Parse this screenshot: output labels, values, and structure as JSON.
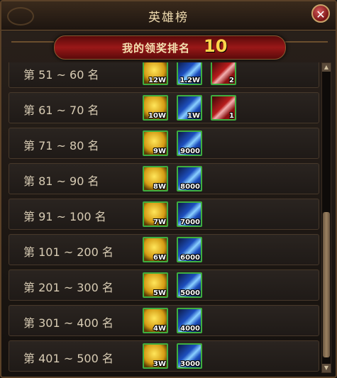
{
  "window": {
    "title": "英雄榜",
    "close_icon": "close-icon"
  },
  "banner": {
    "label": "我的领奖排名",
    "rank": "10"
  },
  "rows": [
    {
      "rank": "第 51 ~ 60 名",
      "rewards": [
        {
          "type": "gold",
          "qty": "12W"
        },
        {
          "type": "crystal",
          "qty": "1.2W"
        },
        {
          "type": "box",
          "qty": "2"
        }
      ]
    },
    {
      "rank": "第 61 ~ 70 名",
      "rewards": [
        {
          "type": "gold",
          "qty": "10W"
        },
        {
          "type": "crystal",
          "qty": "1W"
        },
        {
          "type": "box",
          "qty": "1"
        }
      ]
    },
    {
      "rank": "第 71 ~ 80 名",
      "rewards": [
        {
          "type": "gold",
          "qty": "9W"
        },
        {
          "type": "crystal",
          "qty": "9000"
        }
      ]
    },
    {
      "rank": "第 81 ~ 90 名",
      "rewards": [
        {
          "type": "gold",
          "qty": "8W"
        },
        {
          "type": "crystal",
          "qty": "8000"
        }
      ]
    },
    {
      "rank": "第 91 ~ 100 名",
      "rewards": [
        {
          "type": "gold",
          "qty": "7W"
        },
        {
          "type": "crystal",
          "qty": "7000"
        }
      ]
    },
    {
      "rank": "第 101 ~ 200 名",
      "rewards": [
        {
          "type": "gold",
          "qty": "6W"
        },
        {
          "type": "crystal",
          "qty": "6000"
        }
      ]
    },
    {
      "rank": "第 201 ~ 300 名",
      "rewards": [
        {
          "type": "gold",
          "qty": "5W"
        },
        {
          "type": "crystal",
          "qty": "5000"
        }
      ]
    },
    {
      "rank": "第 301 ~ 400 名",
      "rewards": [
        {
          "type": "gold",
          "qty": "4W"
        },
        {
          "type": "crystal",
          "qty": "4000"
        }
      ]
    },
    {
      "rank": "第 401 ~ 500 名",
      "rewards": [
        {
          "type": "gold",
          "qty": "3W"
        },
        {
          "type": "crystal",
          "qty": "3000"
        }
      ]
    }
  ],
  "scrollbar": {
    "up_icon": "arrow-up-icon",
    "down_icon": "arrow-down-icon"
  }
}
